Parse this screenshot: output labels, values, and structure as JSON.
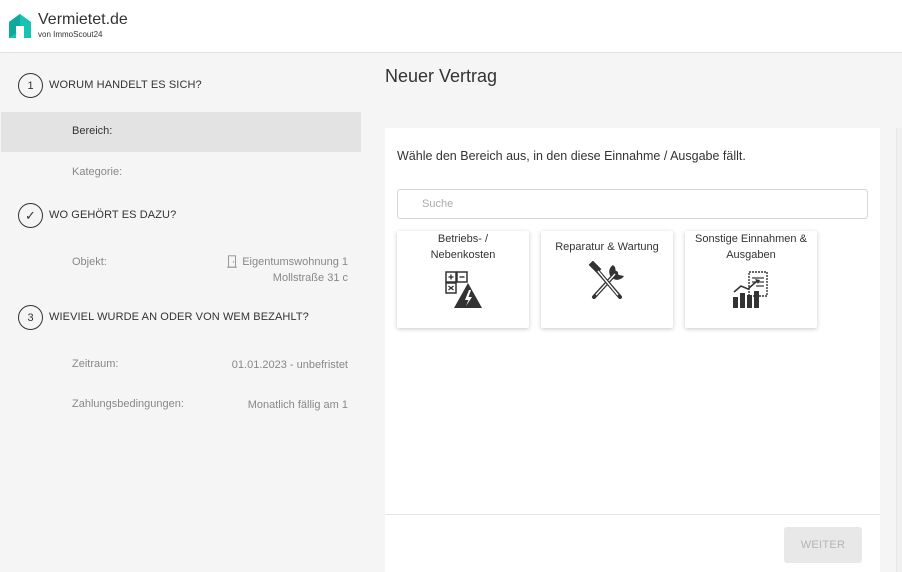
{
  "brand": {
    "title": "Vermietet.de",
    "subtitle": "von ImmoScout24",
    "accent_color": "#17c3b2"
  },
  "sidebar": {
    "steps": [
      {
        "marker": "1",
        "title": "WORUM HANDELT ES SICH?",
        "items": [
          {
            "label": "Bereich:",
            "value": ""
          },
          {
            "label": "Kategorie:",
            "value": ""
          }
        ]
      },
      {
        "marker": "✓",
        "title": "WO GEHÖRT ES DAZU?",
        "items": [
          {
            "label": "Objekt:",
            "value_line1": "Eigentumswohnung 1",
            "value_line2": "Mollstraße 31 c",
            "icon": "door-icon"
          }
        ]
      },
      {
        "marker": "3",
        "title": "WIEVIEL WURDE AN ODER VON WEM BEZAHLT?",
        "items": [
          {
            "label": "Zeitraum:",
            "value": "01.01.2023 - unbefristet"
          },
          {
            "label": "Zahlungsbedingungen:",
            "value": "Monatlich fällig am 1"
          }
        ]
      }
    ]
  },
  "main": {
    "title": "Neuer Vertrag",
    "prompt": "Wähle den Bereich aus, in den diese Einnahme / Ausgabe fällt.",
    "search": {
      "placeholder": "Suche",
      "value": ""
    },
    "tiles": [
      {
        "line1": "Betriebs- /",
        "line2": "Nebenkosten",
        "icon": "utilities-icon"
      },
      {
        "line1": "Reparatur & Wartung",
        "line2": "",
        "icon": "tools-icon"
      },
      {
        "line1": "Sonstige Einnahmen &",
        "line2": "Ausgaben",
        "icon": "finance-chart-icon"
      }
    ],
    "next_button": "WEITER"
  }
}
